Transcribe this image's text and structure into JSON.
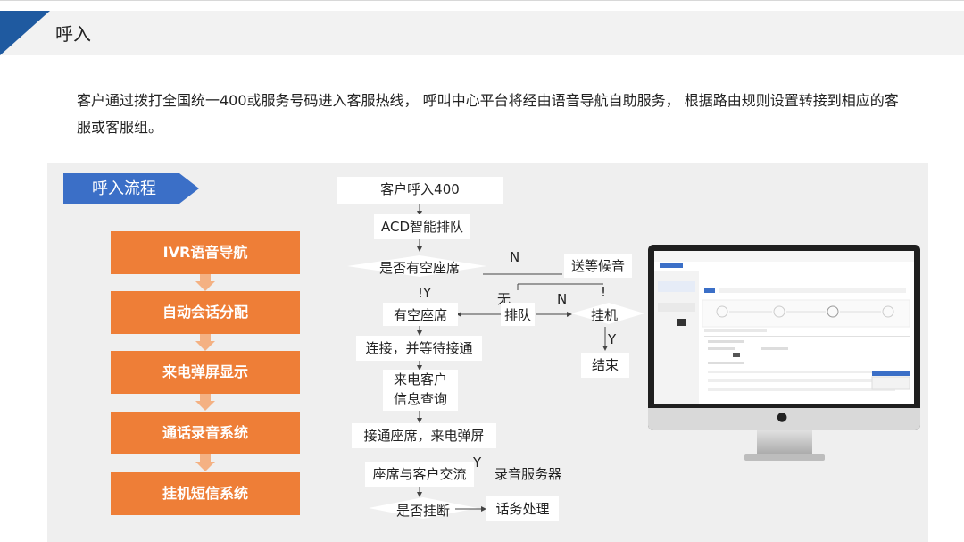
{
  "slide": {
    "title": "呼入",
    "intro": "客户通过拨打全国统一400或服务号码进入客服热线， 呼叫中心平台将经由语音导航自助服务， 根据路由规则设置转接到相应的客服或客服组。"
  },
  "colors": {
    "brand_blue": "#1f5aa0",
    "header_blue": "#3b6fc7",
    "stage_orange": "#ee7e37",
    "arrow_orange": "#f4b183",
    "panel_gray": "#efefef"
  },
  "flow_header": "呼入流程",
  "stages": [
    "IVR语音导航",
    "自动会话分配",
    "来电弹屏显示",
    "通话录音系统",
    "挂机短信系统"
  ],
  "flow": {
    "call_in": "客户呼入400",
    "acd": "ACD智能排队",
    "check_seat": "是否有空座席",
    "no_label": "N",
    "hold_music": "送等候音",
    "yes_label": "!Y",
    "bang": "!",
    "none": "无",
    "queue": "排队",
    "no_label_2": "N",
    "has_seat": "有空座席",
    "hang_up": "挂机",
    "yes_label_2": "Y",
    "end": "结束",
    "connect_wait": "连接，并等待接通",
    "caller_info_1": "来电客户",
    "caller_info_2": "信息查询",
    "pop_screen": "接通座席，来电弹屏",
    "agent_talk": "座席与客户交流",
    "yes_label_3": "Y",
    "record_server": "录音服务器",
    "is_hangup": "是否挂断",
    "process": "话务处理"
  },
  "monitor_icon": "apple-logo-icon"
}
